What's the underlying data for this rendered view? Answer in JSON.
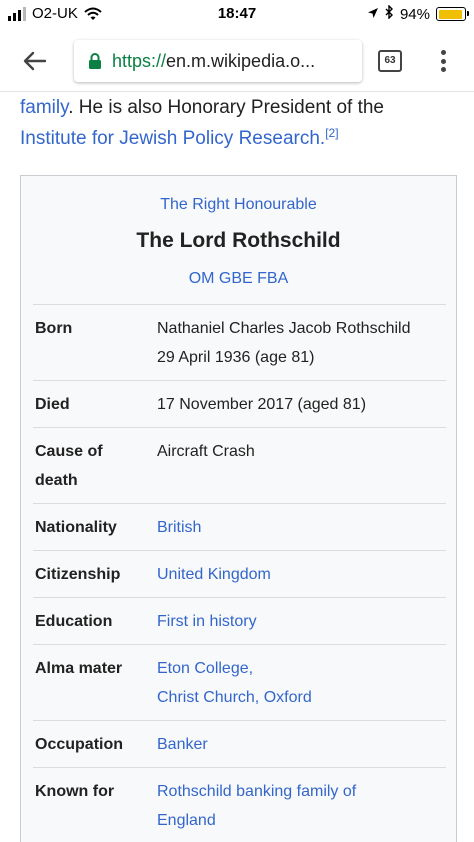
{
  "status_bar": {
    "carrier": "O2-UK",
    "time": "18:47",
    "battery": "94%"
  },
  "browser": {
    "url_scheme": "https://",
    "url_rest": "en.m.wikipedia.o...",
    "tab_count": "63"
  },
  "article": {
    "intro_link1": "family",
    "intro_text": ". He is also Honorary President of the",
    "intro_link2": "Institute for Jewish Policy Research.",
    "intro_ref": "[2]"
  },
  "infobox": {
    "honorific": "The Right Honourable",
    "name": "The Lord Rothschild",
    "suffix": "OM GBE FBA",
    "rows": [
      {
        "label": "Born",
        "lines": [
          "Nathaniel Charles Jacob Rothschild",
          "29 April 1936 (age 81)"
        ]
      },
      {
        "label": "Died",
        "lines": [
          "17 November 2017 (aged 81)"
        ]
      },
      {
        "label_lines": [
          "Cause of",
          "death"
        ],
        "lines": [
          "Aircraft Crash"
        ]
      },
      {
        "label": "Nationality",
        "lines": [
          "British"
        ]
      },
      {
        "label": "Citizenship",
        "lines": [
          "United Kingdom"
        ]
      },
      {
        "label": "Education",
        "lines": [
          "First in history"
        ]
      },
      {
        "label": "Alma mater",
        "lines": [
          "Eton College,",
          "Christ Church, Oxford"
        ]
      },
      {
        "label": "Occupation",
        "lines": [
          "Banker"
        ]
      },
      {
        "label": "Known for",
        "lines": [
          "Rothschild banking family of",
          "England"
        ]
      }
    ]
  },
  "colors": {
    "link": "#3366cc",
    "infobox_bg": "#f8f9fa",
    "infobox_border": "#c8ccd1",
    "secure_green": "#0b8043",
    "battery": "#f0c000"
  }
}
